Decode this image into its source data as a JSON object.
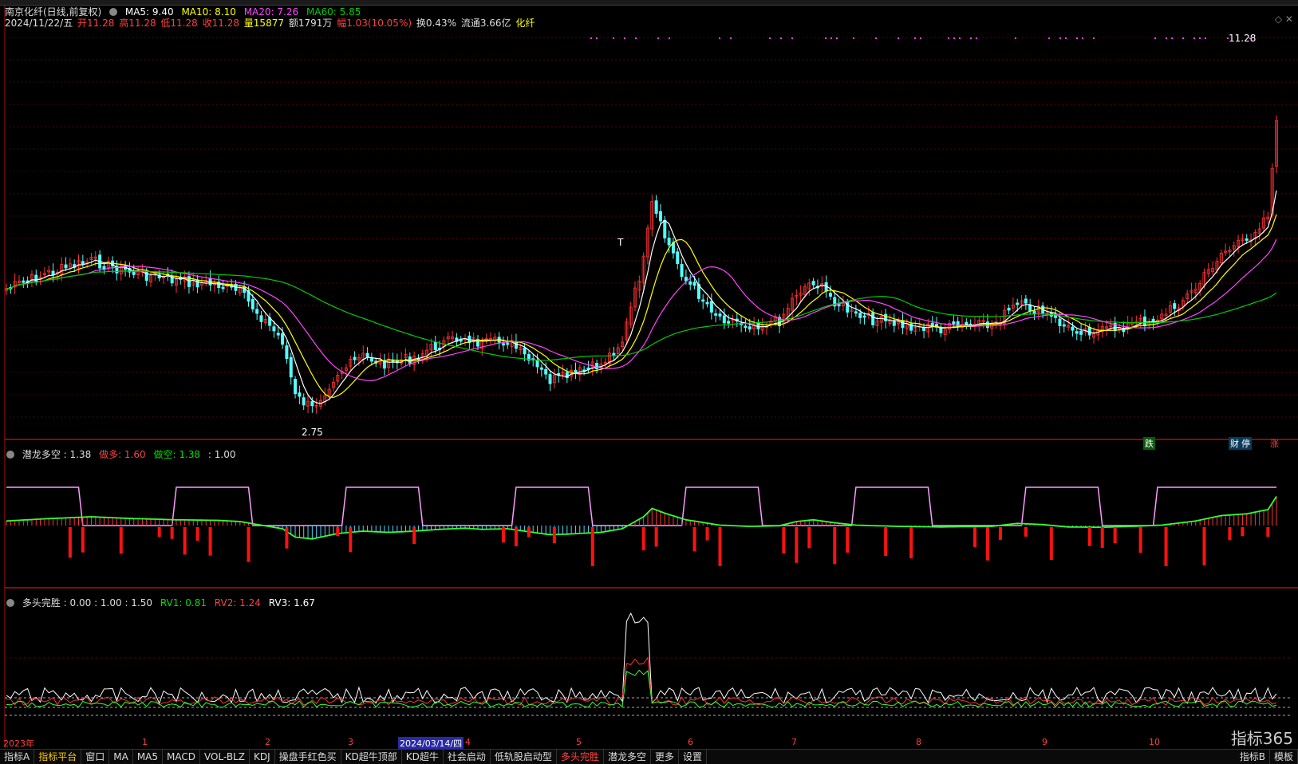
{
  "header": {
    "stock_name": "南京化纤(日线,前复权)",
    "ma5": "MA5: 9.40",
    "ma10": "MA10: 8.10",
    "ma20": "MA20: 7.26",
    "ma60": "MA60: 5.85",
    "date": "2024/11/22/五",
    "open": "开11.28",
    "high": "高11.28",
    "low": "低11.28",
    "close": "收11.28",
    "volume": "量15877",
    "amount": "额1791万",
    "change": "幅1.03(10.05%)",
    "turnover": "换0.43%",
    "float": "流通3.66亿",
    "sector": "化纤"
  },
  "main_chart": {
    "max_label": "11.28",
    "min_label": "2.75",
    "t_marker": "T",
    "signals": {
      "fall": "跌",
      "finance": "财",
      "stop": "停",
      "rise": "涨"
    }
  },
  "indicator1": {
    "name": "潜龙多空",
    "value1": ": 1.38",
    "long_label": "做多: 1.60",
    "short_label": "做空: 1.38",
    "value2": ": 1.00"
  },
  "indicator2": {
    "name": "多头完胜",
    "values": ": 0.00 : 1.00 : 1.50",
    "rv1": "RV1: 0.81",
    "rv2": "RV2: 1.24",
    "rv3": "RV3: 1.67"
  },
  "xaxis": {
    "labels": [
      "2023年",
      "1",
      "2",
      "3",
      "2024/03/14/四",
      "4",
      "5",
      "6",
      "7",
      "8",
      "9",
      "10"
    ]
  },
  "bottom_tabs": [
    "指标A",
    "指标平台",
    "窗口",
    "MA",
    "MA5",
    "MACD",
    "VOL-BLZ",
    "KDJ",
    "操盘手红色买",
    "KD超牛顶部",
    "KD超牛",
    "社会启动",
    "低轨股启动型",
    "多头完胜",
    "潜龙多空",
    "更多",
    "设置"
  ],
  "right_tabs": [
    "指标B",
    "模板"
  ],
  "logo": "指标365",
  "colors": {
    "ma5": "#ffffff",
    "ma10": "#ffff00",
    "ma20": "#ff44ff",
    "ma60": "#00cc00",
    "up": "#ff3333",
    "down": "#54ffff"
  }
}
